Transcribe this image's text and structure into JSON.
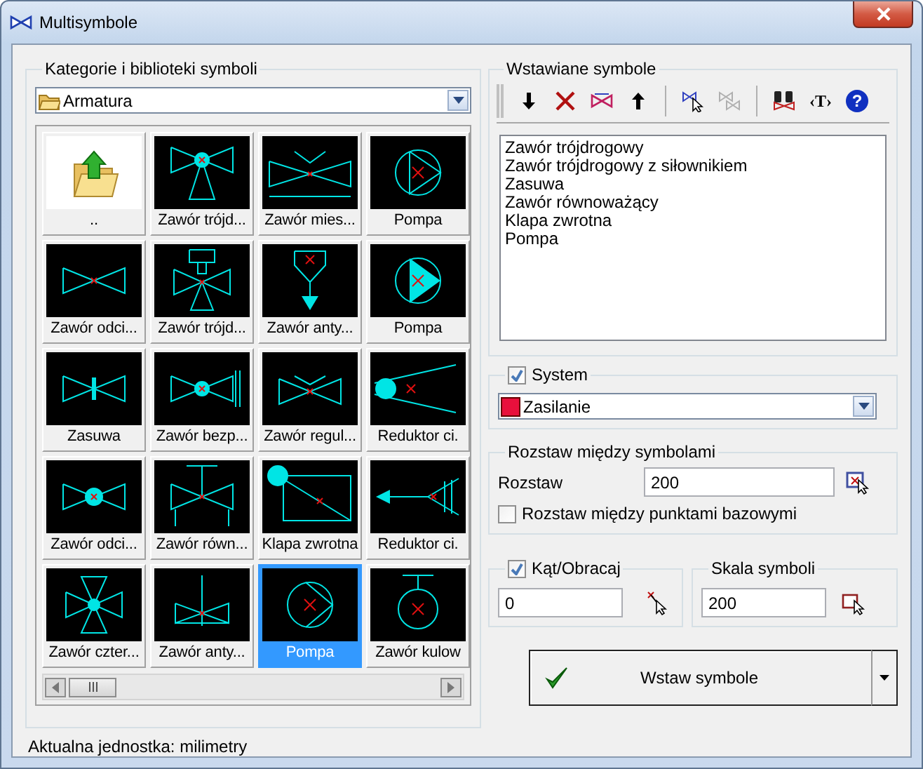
{
  "window": {
    "title": "Multisymbole"
  },
  "library": {
    "title": "Kategorie i biblioteki symboli",
    "category": "Armatura",
    "symbols": [
      {
        "label": "..",
        "selected": false
      },
      {
        "label": "Zawór trójd...",
        "selected": false
      },
      {
        "label": "Zawór mies...",
        "selected": false
      },
      {
        "label": "Pompa",
        "selected": false
      },
      {
        "label": "Zawór odci...",
        "selected": false
      },
      {
        "label": "Zawór trójd...",
        "selected": false
      },
      {
        "label": "Zawór anty...",
        "selected": false
      },
      {
        "label": "Pompa",
        "selected": false
      },
      {
        "label": "Zasuwa",
        "selected": false
      },
      {
        "label": "Zawór bezp...",
        "selected": false
      },
      {
        "label": "Zawór regul...",
        "selected": false
      },
      {
        "label": "Reduktor ci.",
        "selected": false
      },
      {
        "label": "Zawór odci...",
        "selected": false
      },
      {
        "label": "Zawór równ...",
        "selected": false
      },
      {
        "label": "Klapa zwrotna",
        "selected": false
      },
      {
        "label": "Reduktor ci.",
        "selected": false
      },
      {
        "label": "Zawór czter...",
        "selected": false
      },
      {
        "label": "Zawór anty...",
        "selected": false
      },
      {
        "label": "Pompa",
        "selected": true
      },
      {
        "label": "Zawór kulow",
        "selected": false
      }
    ]
  },
  "status": "Aktualna jednostka: milimetry",
  "inserted": {
    "title": "Wstawiane symbole",
    "toolbar": [
      [
        {
          "kind": "down",
          "disabled": false
        },
        {
          "kind": "delete",
          "disabled": false
        },
        {
          "kind": "symbol",
          "disabled": false
        },
        {
          "kind": "up",
          "disabled": false
        }
      ],
      [
        {
          "kind": "pick",
          "disabled": false
        },
        {
          "kind": "swap",
          "disabled": true
        }
      ],
      [
        {
          "kind": "find",
          "disabled": false
        },
        {
          "kind": "text",
          "label": "‹T›",
          "disabled": false
        },
        {
          "kind": "help",
          "label": "?",
          "disabled": false
        }
      ]
    ],
    "items": [
      "Zawór trójdrogowy",
      "Zawór trójdrogowy z siłownikiem",
      "Zasuwa",
      "Zawór równoważący",
      "Klapa zwrotna",
      "Pompa"
    ]
  },
  "system": {
    "label": "System",
    "checked": true,
    "value": "Zasilanie",
    "color": "#e8103c"
  },
  "spacing": {
    "title": "Rozstaw między symbolami",
    "label": "Rozstaw",
    "value": "200",
    "base_points": {
      "label": "Rozstaw między punktami bazowymi",
      "checked": false
    }
  },
  "angle": {
    "label": "Kąt/Obracaj",
    "checked": true,
    "value": "0"
  },
  "scale": {
    "title": "Skala symboli",
    "value": "200"
  },
  "insert_button": {
    "label": "Wstaw symbole"
  }
}
